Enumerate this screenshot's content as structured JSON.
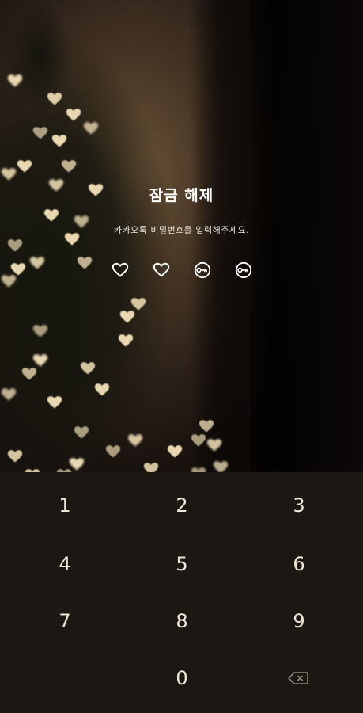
{
  "lock": {
    "title": "잠금 해제",
    "subtitle": "카카오톡 비밀번호를 입력해주세요."
  },
  "pin_slots": [
    {
      "state": "filled",
      "icon": "heart-icon"
    },
    {
      "state": "filled",
      "icon": "heart-icon"
    },
    {
      "state": "empty",
      "icon": "key-icon"
    },
    {
      "state": "empty",
      "icon": "key-icon"
    }
  ],
  "keypad": {
    "keys": [
      "1",
      "2",
      "3",
      "4",
      "5",
      "6",
      "7",
      "8",
      "9",
      "",
      "0",
      "backspace"
    ],
    "backspace_icon": "backspace-icon"
  },
  "colors": {
    "keypad_bg": "#1b1814",
    "key_text": "#efe7d6",
    "title_text": "#ffffff",
    "bokeh": "#e8d7b0"
  }
}
